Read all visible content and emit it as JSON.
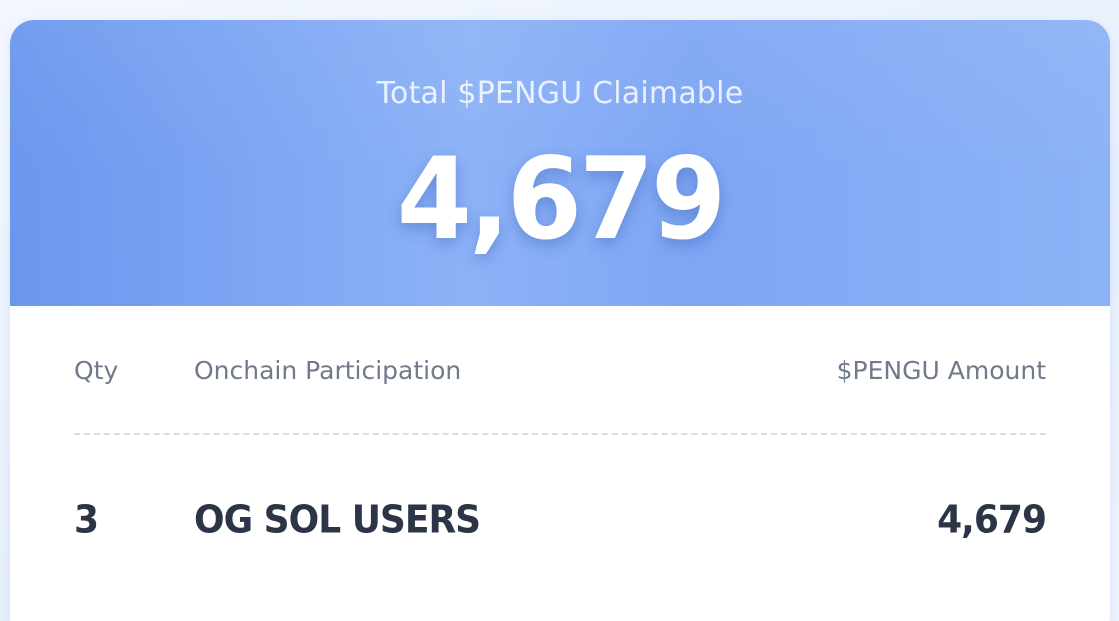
{
  "header": {
    "label": "Total $PENGU Claimable",
    "total": "4,679"
  },
  "table": {
    "columns": {
      "qty": "Qty",
      "participation": "Onchain Participation",
      "amount": "$PENGU Amount"
    },
    "rows": [
      {
        "qty": "3",
        "participation": "OG SOL USERS",
        "amount": "4,679"
      }
    ]
  }
}
